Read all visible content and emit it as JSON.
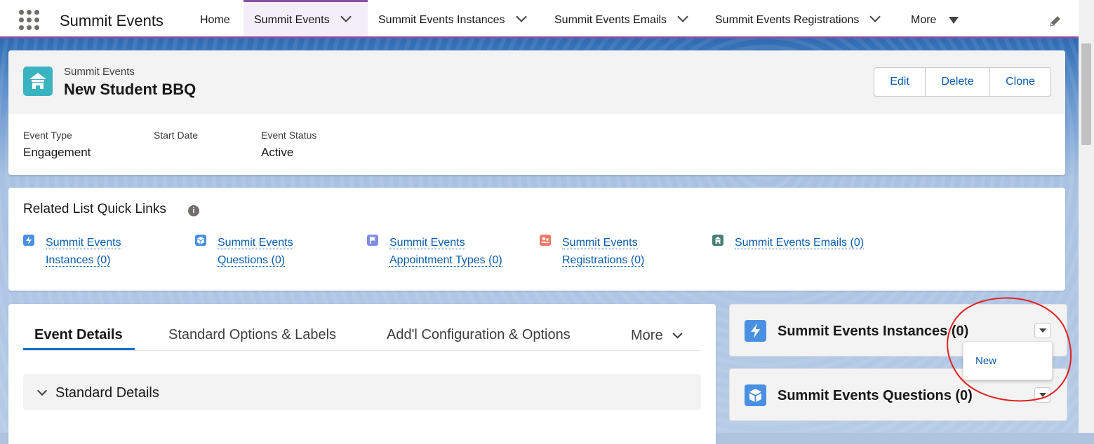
{
  "nav": {
    "app_title": "Summit Events",
    "items": [
      {
        "label": "Home"
      },
      {
        "label": "Summit Events"
      },
      {
        "label": "Summit Events Instances"
      },
      {
        "label": "Summit Events Emails"
      },
      {
        "label": "Summit Events Registrations"
      },
      {
        "label": "More"
      }
    ]
  },
  "record": {
    "object_label": "Summit Events",
    "name": "New Student BBQ",
    "actions": {
      "edit": "Edit",
      "delete": "Delete",
      "clone": "Clone"
    },
    "fields": [
      {
        "label": "Event Type",
        "value": "Engagement"
      },
      {
        "label": "Start Date",
        "value": ""
      },
      {
        "label": "Event Status",
        "value": "Active"
      }
    ]
  },
  "quick_links": {
    "title": "Related List Quick Links",
    "info_glyph": "i",
    "items": [
      {
        "line1": "Summit Events",
        "line2": "Instances (0)",
        "icon": "lightning-icon",
        "color": "#4a90e2"
      },
      {
        "line1": "Summit Events",
        "line2": "Questions (0)",
        "icon": "cube-icon",
        "color": "#4a90e2"
      },
      {
        "line1": "Summit Events",
        "line2": "Appointment Types (0)",
        "icon": "flag-icon",
        "color": "#7f8de1"
      },
      {
        "line1": "Summit Events",
        "line2": "Registrations (0)",
        "icon": "people-icon",
        "color": "#ef7a6a"
      },
      {
        "line1": "Summit Events Emails (0)",
        "line2": "",
        "icon": "house-icon",
        "color": "#4a7f74"
      }
    ]
  },
  "tabs": {
    "items": [
      {
        "label": "Event Details"
      },
      {
        "label": "Standard Options & Labels"
      },
      {
        "label": "Add'l Configuration & Options"
      },
      {
        "label": "More"
      }
    ],
    "section_title": "Standard Details"
  },
  "related": [
    {
      "title": "Summit Events Instances (0)",
      "icon": "lightning-icon"
    },
    {
      "title": "Summit Events Questions (0)",
      "icon": "cube-icon"
    }
  ],
  "menu": {
    "new_label": "New"
  },
  "colors": {
    "accent": "#8b4fa3",
    "link": "#0b5cab",
    "annotation": "#e02020"
  }
}
